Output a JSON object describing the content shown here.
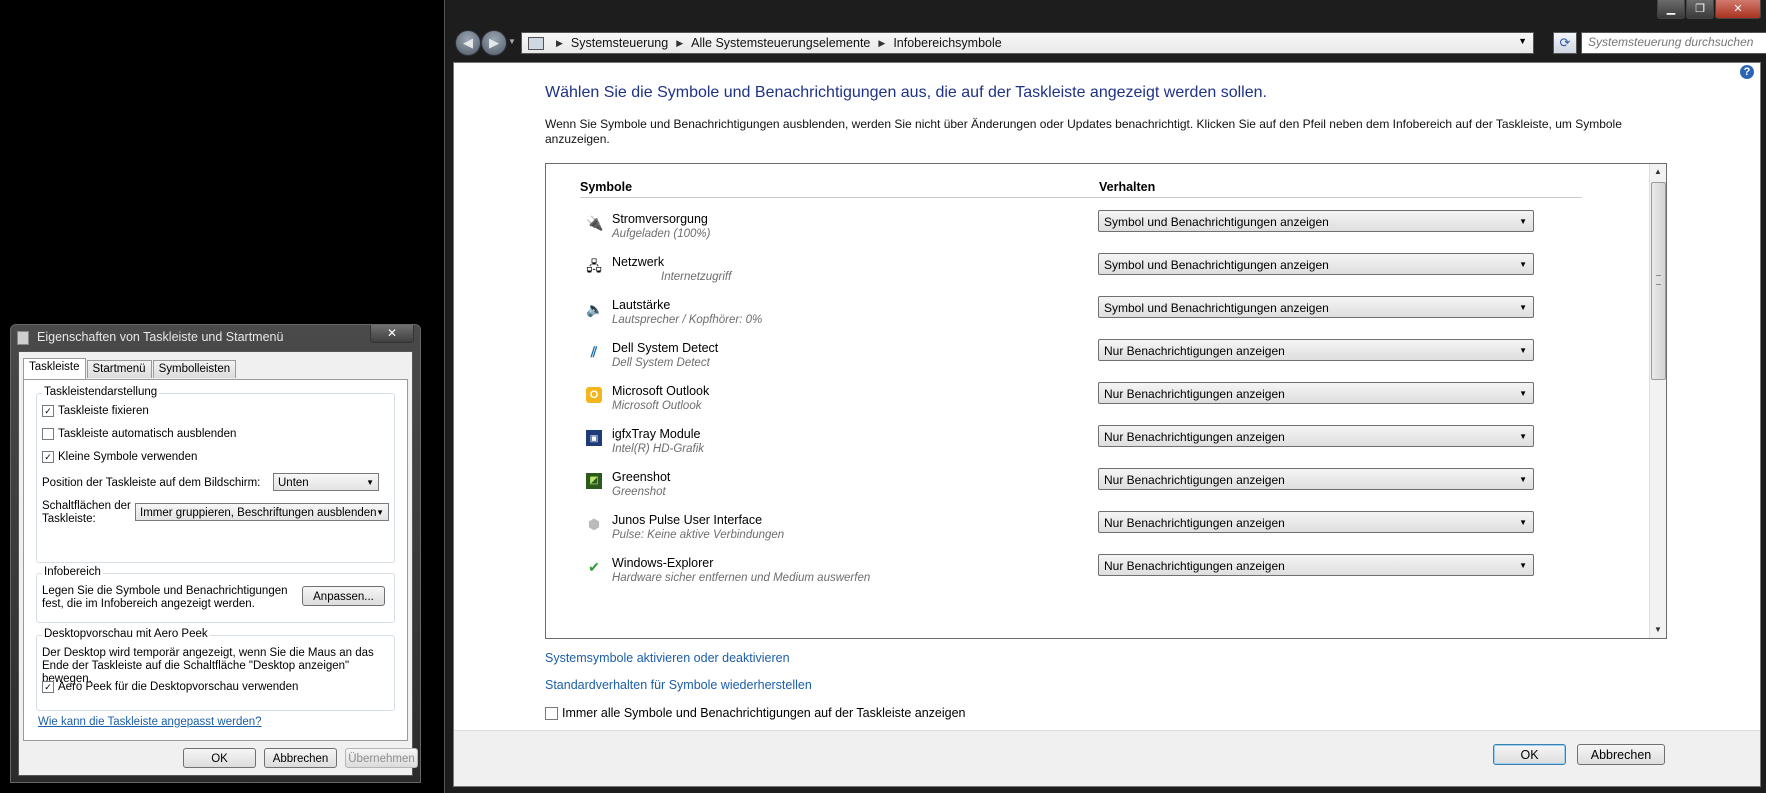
{
  "window": {
    "controls": [
      "▁",
      "❐",
      "✕"
    ]
  },
  "nav": {
    "back": "◀",
    "forward": "▶",
    "crumbs": [
      "Systemsteuerung",
      "Alle Systemsteuerungselemente",
      "Infobereichsymbole"
    ],
    "search_placeholder": "Systemsteuerung durchsuchen",
    "refresh": "⟳"
  },
  "main": {
    "heading": "Wählen Sie die Symbole und Benachrichtigungen aus, die auf der Taskleiste angezeigt werden sollen.",
    "description": "Wenn Sie Symbole und Benachrichtigungen ausblenden, werden Sie nicht über Änderungen oder Updates benachrichtigt. Klicken Sie auf den Pfeil neben dem Infobereich auf der Taskleiste, um Symbole anzuzeigen.",
    "col_symbols": "Symbole",
    "col_behavior": "Verhalten",
    "rows": [
      {
        "name": "Stromversorgung",
        "sub": "Aufgeladen (100%)",
        "behavior": "Symbol und Benachrichtigungen anzeigen",
        "icon": "power-icon"
      },
      {
        "name": "Netzwerk",
        "sub": "Internetzugriff",
        "behavior": "Symbol und Benachrichtigungen anzeigen",
        "icon": "network-icon"
      },
      {
        "name": "Lautstärke",
        "sub": "Lautsprecher / Kopfhörer: 0%",
        "behavior": "Symbol und Benachrichtigungen anzeigen",
        "icon": "speaker-icon"
      },
      {
        "name": "Dell System Detect",
        "sub": "Dell System Detect",
        "behavior": "Nur Benachrichtigungen anzeigen",
        "icon": "dell-icon"
      },
      {
        "name": "Microsoft Outlook",
        "sub": "Microsoft Outlook",
        "behavior": "Nur Benachrichtigungen anzeigen",
        "icon": "outlook-icon"
      },
      {
        "name": "igfxTray Module",
        "sub": "Intel(R) HD-Grafik",
        "behavior": "Nur Benachrichtigungen anzeigen",
        "icon": "intel-graphics-icon"
      },
      {
        "name": "Greenshot",
        "sub": "Greenshot",
        "behavior": "Nur Benachrichtigungen anzeigen",
        "icon": "greenshot-icon"
      },
      {
        "name": "Junos Pulse User Interface",
        "sub": "Pulse:  Keine aktive Verbindungen",
        "behavior": "Nur Benachrichtigungen anzeigen",
        "icon": "junos-pulse-icon"
      },
      {
        "name": "Windows-Explorer",
        "sub": "Hardware sicher entfernen und Medium auswerfen",
        "behavior": "Nur Benachrichtigungen anzeigen",
        "icon": "safely-remove-hardware-icon"
      }
    ],
    "link_system_icons": "Systemsymbole aktivieren oder deaktivieren",
    "link_restore": "Standardverhalten für Symbole wiederherstellen",
    "always_show_label": "Immer alle Symbole und Benachrichtigungen auf der Taskleiste anzeigen",
    "always_show_checked": false,
    "ok": "OK",
    "cancel": "Abbrechen"
  },
  "dialog": {
    "title": "Eigenschaften von Taskleiste und Startmenü",
    "close": "✕",
    "tabs": [
      "Taskleiste",
      "Startmenü",
      "Symbolleisten"
    ],
    "group_appearance": "Taskleistendarstellung",
    "opt_lock": "Taskleiste fixieren",
    "opt_autohide": "Taskleiste automatisch ausblenden",
    "opt_small": "Kleine Symbole verwenden",
    "position_label": "Position der Taskleiste auf dem Bildschirm:",
    "position_value": "Unten",
    "buttons_label": "Schaltflächen der Taskleiste:",
    "buttons_value": "Immer gruppieren, Beschriftungen ausblenden",
    "group_notify": "Infobereich",
    "notify_text": "Legen Sie die Symbole und Benachrichtigungen fest, die im Infobereich angezeigt werden.",
    "customize": "Anpassen...",
    "group_peek": "Desktopvorschau mit Aero Peek",
    "peek_text": "Der Desktop wird temporär angezeigt, wenn Sie die Maus an das Ende der Taskleiste auf die Schaltfläche \"Desktop anzeigen\" bewegen.",
    "opt_peek": "Aero Peek für die Desktopvorschau verwenden",
    "help_link": "Wie kann die Taskleiste angepasst werden?",
    "ok": "OK",
    "cancel": "Abbrechen",
    "apply": "Übernehmen"
  },
  "colors": {
    "heading": "#1e3287",
    "link": "#1b5eaa"
  }
}
